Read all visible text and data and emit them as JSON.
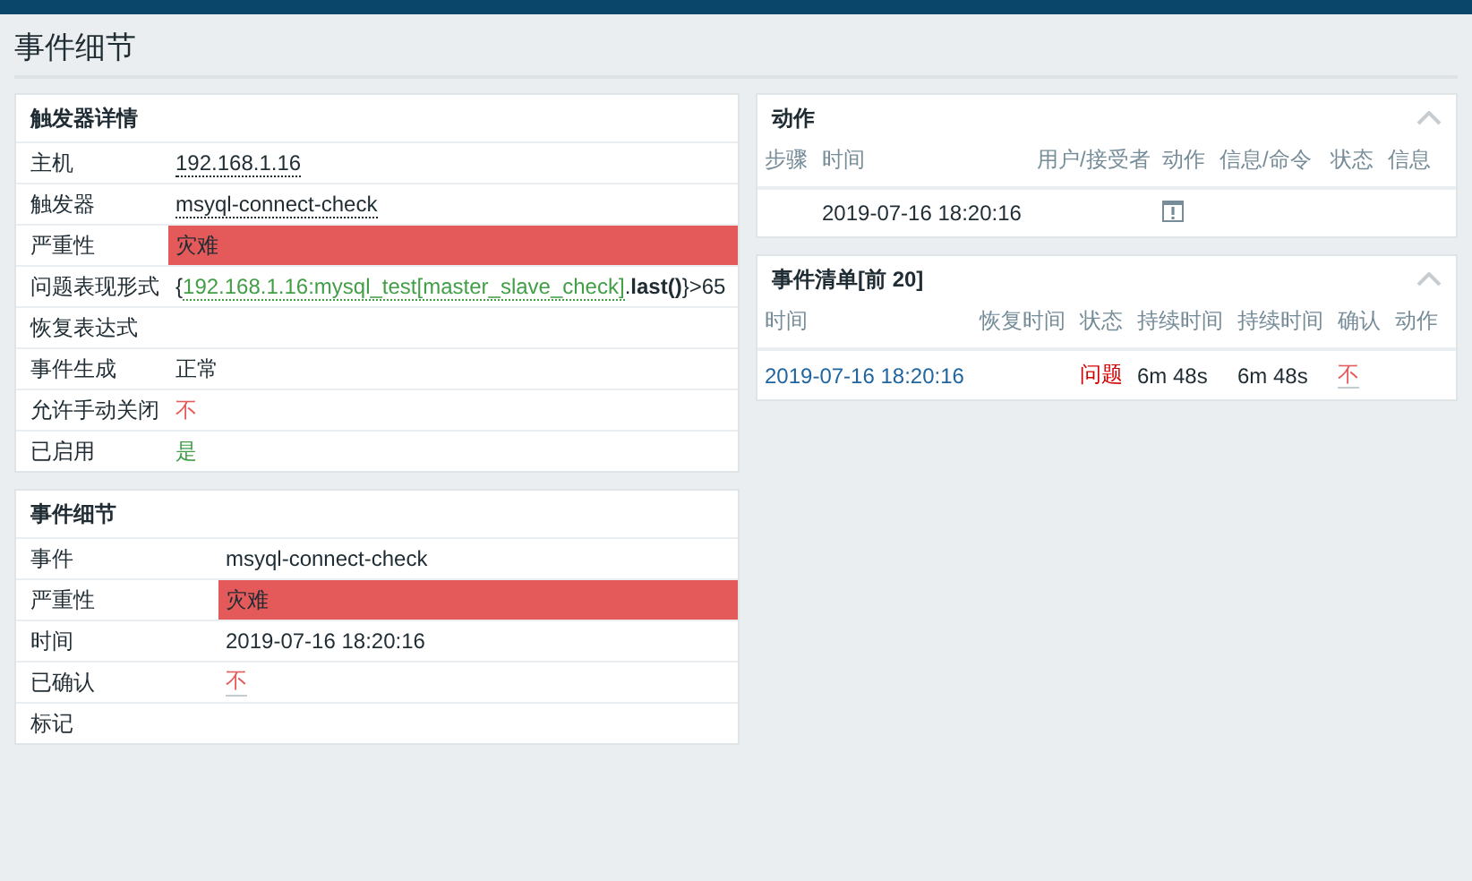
{
  "page_title": "事件细节",
  "trigger_details": {
    "title": "触发器详情",
    "rows": [
      {
        "label": "主机",
        "kind": "link",
        "value": "192.168.1.16"
      },
      {
        "label": "触发器",
        "kind": "link",
        "value": "msyql-connect-check"
      },
      {
        "label": "严重性",
        "kind": "severity",
        "value": "灾难"
      },
      {
        "label": "问题表现形式",
        "kind": "expression",
        "parts": [
          {
            "kind": "plain",
            "text": "{"
          },
          {
            "kind": "link",
            "text": "192.168.1.16:mysql_test[master_slave_check]"
          },
          {
            "kind": "plain",
            "text": "."
          },
          {
            "kind": "bold",
            "text": "last()"
          },
          {
            "kind": "plain",
            "text": "}>65"
          }
        ]
      },
      {
        "label": "恢复表达式",
        "kind": "empty"
      },
      {
        "label": "事件生成",
        "kind": "plain",
        "value": "正常"
      },
      {
        "label": "允许手动关闭",
        "kind": "no",
        "value": "不"
      },
      {
        "label": "已启用",
        "kind": "yes",
        "value": "是"
      }
    ]
  },
  "event_details": {
    "title": "事件细节",
    "rows": [
      {
        "label": "事件",
        "kind": "plain",
        "value": "msyql-connect-check"
      },
      {
        "label": "严重性",
        "kind": "severity",
        "value": "灾难"
      },
      {
        "label": "时间",
        "kind": "plain",
        "value": "2019-07-16 18:20:16"
      },
      {
        "label": "已确认",
        "kind": "ack",
        "value": "不"
      },
      {
        "label": "标记",
        "kind": "empty"
      }
    ]
  },
  "actions": {
    "title": "动作",
    "expanded": true,
    "columns": [
      "步骤",
      "时间",
      "用户/接受者",
      "动作",
      "信息/命令",
      "状态",
      "信息"
    ],
    "rows": [
      {
        "time": "2019-07-16 18:20:16"
      }
    ]
  },
  "events": {
    "title": "事件清单[前 20]",
    "expanded": true,
    "columns": [
      "时间",
      "恢复时间",
      "状态",
      "持续时间",
      "持续时间",
      "确认",
      "动作"
    ],
    "rows": [
      {
        "time": "2019-07-16 18:20:16",
        "status": "问题",
        "duration_1": "6m 48s",
        "duration_2": "6m 48s",
        "acknowledged": "不"
      }
    ]
  }
}
